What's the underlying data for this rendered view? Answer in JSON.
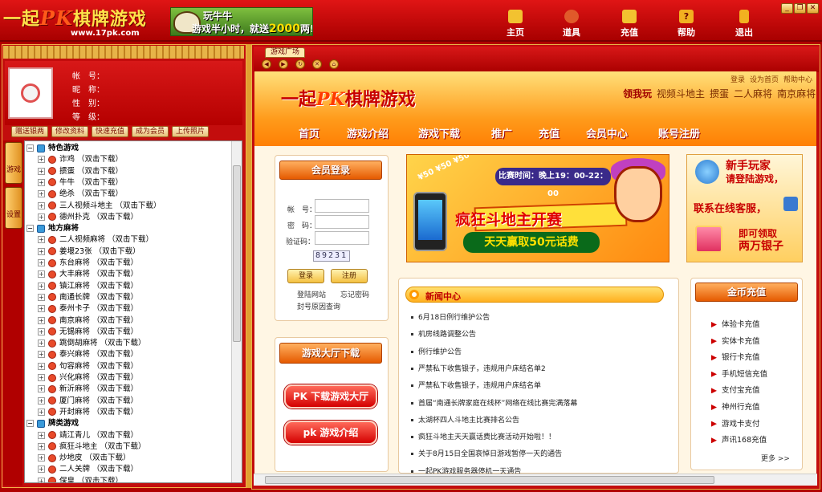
{
  "app": {
    "logo_text": "一起PK棋牌游戏",
    "logo_pk": "PK",
    "logo_pre": "一起",
    "logo_post": "棋牌游戏",
    "logo_url": "www.17pk.com",
    "banner_line1": "玩牛牛",
    "banner_line2": "游戏半小时，就送",
    "banner_amount": "2000",
    "banner_unit": "两!",
    "nav": [
      {
        "label": "主页",
        "icon": "home-icon",
        "color": "#f2c230"
      },
      {
        "label": "道具",
        "icon": "props-icon",
        "color": "#e05a2a"
      },
      {
        "label": "充值",
        "icon": "recharge-icon",
        "color": "#f2c230"
      },
      {
        "label": "帮助",
        "icon": "help-icon",
        "color": "#f2b020"
      },
      {
        "label": "退出",
        "icon": "exit-icon",
        "color": "#f2b020"
      }
    ],
    "win_buttons": [
      "_",
      "❐",
      "✕"
    ]
  },
  "profile": {
    "fields": [
      "帐　号：",
      "昵　称：",
      "性　别：",
      "等　级："
    ],
    "buttons": [
      "赠送银两",
      "修改资料",
      "快速充值",
      "成为会员",
      "上传照片"
    ]
  },
  "side_tabs": [
    "游戏",
    "设置"
  ],
  "tree": [
    {
      "type": "cat",
      "label": "特色游戏"
    },
    {
      "type": "item",
      "label": "诈鸡 （双击下载）"
    },
    {
      "type": "item",
      "label": "掼蛋 （双击下载）"
    },
    {
      "type": "item",
      "label": "牛牛 （双击下载）"
    },
    {
      "type": "item",
      "label": "绝杀 （双击下载）"
    },
    {
      "type": "item",
      "label": "三人视频斗地主 （双击下载）"
    },
    {
      "type": "item",
      "label": "德州扑克 （双击下载）"
    },
    {
      "type": "cat",
      "label": "地方麻将"
    },
    {
      "type": "item",
      "label": "二人视频麻将 （双击下载）"
    },
    {
      "type": "item",
      "label": "姜堰23张 （双击下载）"
    },
    {
      "type": "item",
      "label": "东台麻将 （双击下载）"
    },
    {
      "type": "item",
      "label": "大丰麻将 （双击下载）"
    },
    {
      "type": "item",
      "label": "镇江麻将 （双击下载）"
    },
    {
      "type": "item",
      "label": "南通长牌 （双击下载）"
    },
    {
      "type": "item",
      "label": "泰州卡子 （双击下载）"
    },
    {
      "type": "item",
      "label": "南京麻将 （双击下载）"
    },
    {
      "type": "item",
      "label": "无锡麻将 （双击下载）"
    },
    {
      "type": "item",
      "label": "跳倒胡麻将 （双击下载）"
    },
    {
      "type": "item",
      "label": "泰兴麻将 （双击下载）"
    },
    {
      "type": "item",
      "label": "句容麻将 （双击下载）"
    },
    {
      "type": "item",
      "label": "兴化麻将 （双击下载）"
    },
    {
      "type": "item",
      "label": "新沂麻将 （双击下载）"
    },
    {
      "type": "item",
      "label": "厦门麻将 （双击下载）"
    },
    {
      "type": "item",
      "label": "开封麻将 （双击下载）"
    },
    {
      "type": "cat",
      "label": "牌类游戏"
    },
    {
      "type": "item",
      "label": "靖江青儿 （双击下载）"
    },
    {
      "type": "item",
      "label": "疯狂斗地主 （双击下载）"
    },
    {
      "type": "item",
      "label": "炒地皮 （双击下载）"
    },
    {
      "type": "item",
      "label": "二人关牌 （双击下载）"
    },
    {
      "type": "item",
      "label": "保皇 （双击下载）"
    }
  ],
  "browser": {
    "tab_label": "游戏广场",
    "nav_buttons": [
      "◀",
      "▶",
      "↻",
      "✕",
      "⌂"
    ]
  },
  "site": {
    "top_links": [
      "登录",
      "设为首页",
      "帮助中心"
    ],
    "hot_label": "领我玩",
    "hot_games": [
      "视频斗地主",
      "掼蛋",
      "二人麻将",
      "南京麻将"
    ],
    "menu": [
      "首页",
      "游戏介绍",
      "游戏下载",
      "推广",
      "充值",
      "会员中心",
      "账号注册"
    ],
    "login": {
      "title": "会员登录",
      "account": "帐　号：",
      "password": "密　码：",
      "captcha_label": "验证码：",
      "captcha_value": "89231",
      "login_btn": "登录",
      "register_btn": "注册",
      "link_login_site": "登陆网站",
      "link_forgot": "忘记密码",
      "link_ban": "封号原因查询"
    },
    "download": {
      "title": "游戏大厅下载",
      "btn1": "PK 下载游戏大厅",
      "btn2": "pk 游戏介绍"
    },
    "promo": {
      "coins": "¥50 ¥50 ¥50 ¥50",
      "time": "比赛时间：晚上19：00-22：00",
      "title": "疯狂斗地主开赛",
      "win": "天天赢取50元话费"
    },
    "side_ad": {
      "line1a": "新手玩家",
      "line1b": "请登陆游戏，",
      "line2": "联系在线客服，",
      "line3a": "即可领取",
      "line3b": "两万银子"
    },
    "news": {
      "title": "新闻中心",
      "items": [
        "6月18日例行维护公告",
        "机房线路调整公告",
        "例行维护公告",
        "严禁私下收售银子，违规用户床结名单2",
        "严禁私下收售银子，违规用户床结名单",
        "首届“南通长牌家庭在线杯”网络在线比赛完满落幕",
        "太湖杯四人斗地主比赛排名公告",
        "疯狂斗地主天天赢话费比赛活动开始啦！！",
        "关于8月15日全国哀悼日游戏暂停一天的通告",
        "一起PK游戏服务器停机一天通告"
      ]
    },
    "recharge": {
      "title": "金币充值",
      "items": [
        "体验卡充值",
        "实体卡充值",
        "银行卡充值",
        "手机短信充值",
        "支付宝充值",
        "神州行充值",
        "游戏卡支付",
        "声讯168充值"
      ],
      "more": "更多 >>"
    }
  }
}
